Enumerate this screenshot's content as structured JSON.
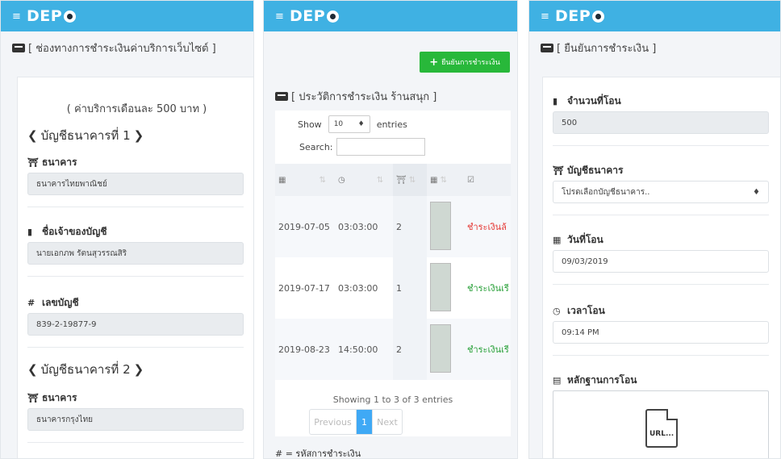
{
  "brand": "DEP",
  "panel1": {
    "section_title": "[ ช่องทางการชำระเงินค่าบริการเว็บไซต์ ]",
    "fee_text": "( ค่าบริการเดือนละ 500 บาท )",
    "bank1_title": "บัญชีธนาคารที่ 1",
    "bank_label": "ธนาคาร",
    "bank1_value": "ธนาคารไทยพาณิชย์",
    "owner_label": "ชื่อเจ้าของบัญชี",
    "owner1_value": "นายเอกภพ รัตนสุวรรณสิริ",
    "acct_label": "เลขบัญชี",
    "acct1_value": "839-2-19877-9",
    "bank2_title": "บัญชีธนาคารที่ 2",
    "bank2_value": "ธนาคารกรุงไทย"
  },
  "panel2": {
    "confirm_button": "ยืนยันการชำระเงิน",
    "section_title": "[ ประวัติการชำระเงิน ร้านสนุก ]",
    "show_label": "Show",
    "entries_label": "entries",
    "show_value": "10",
    "search_label": "Search:",
    "rows": [
      {
        "date": "2019-07-05",
        "time": "03:03:00",
        "bank": "2",
        "status": "ชำระเงินล้",
        "status_color": "#e53935"
      },
      {
        "date": "2019-07-17",
        "time": "03:03:00",
        "bank": "1",
        "status": "ชำระเงินเรี",
        "status_color": "#2aa13a"
      },
      {
        "date": "2019-08-23",
        "time": "14:50:00",
        "bank": "2",
        "status": "ชำระเงินเรี",
        "status_color": "#2aa13a"
      }
    ],
    "info_text": "Showing 1 to 3 of 3 entries",
    "prev_label": "Previous",
    "page_label": "1",
    "next_label": "Next",
    "footnote": "# = รหัสการชำระเงิน"
  },
  "panel3": {
    "section_title": "[ ยืนยันการชำระเงิน ]",
    "amount_label": "จำนวนที่โอน",
    "amount_value": "500",
    "bank_label": "บัญชีธนาคาร",
    "bank_select": "โปรดเลือกบัญชีธนาคาร..",
    "date_label": "วันที่โอน",
    "date_value": "09/03/2019",
    "time_label": "เวลาโอน",
    "time_value": "09:14 PM",
    "proof_label": "หลักฐานการโอน",
    "upload_text": "URL..."
  }
}
